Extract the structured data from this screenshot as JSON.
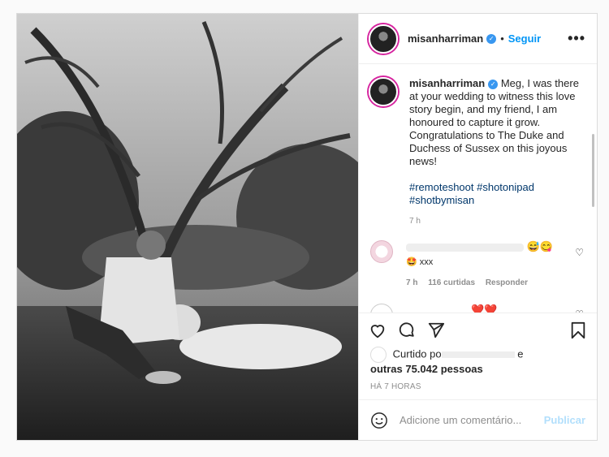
{
  "post": {
    "username": "misanharriman",
    "follow_label": "Seguir",
    "dot": "•",
    "more_label": "•••"
  },
  "caption": {
    "username": "misanharriman",
    "text": "Meg, I was there at your wedding to witness this love story begin, and my friend, I am honoured to capture it grow. Congratulations to The Duke and Duchess of Sussex on this joyous news!",
    "hashtags": "#remoteshoot #shotonipad #shotbymisan",
    "time": "7 h"
  },
  "comments": [
    {
      "text": "xxx",
      "emoji": "😅😋",
      "lead_emoji": "🤩",
      "time": "7 h",
      "likes": "116 curtidas",
      "reply": "Responder"
    },
    {
      "emoji": "❤️❤️"
    }
  ],
  "likes": {
    "prefix": "Curtido po",
    "suffix": "e",
    "others": "outras 75.042 pessoas"
  },
  "timestamp": "HÁ 7 HORAS",
  "add_comment": {
    "placeholder": "Adicione um comentário...",
    "post_label": "Publicar"
  },
  "colors": {
    "accent": "#0095f6",
    "link": "#00376b",
    "muted": "#8e8e8e"
  }
}
